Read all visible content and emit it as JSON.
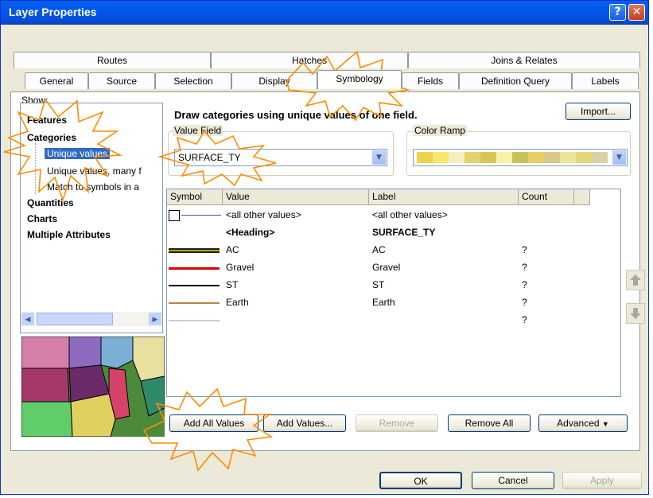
{
  "window": {
    "title": "Layer Properties",
    "help_label": "?",
    "close_label": "✕"
  },
  "tabs_row1": [
    "Routes",
    "Hatches",
    "Joins & Relates"
  ],
  "tabs_row2": [
    "General",
    "Source",
    "Selection",
    "Display",
    "Symbology",
    "Fields",
    "Definition Query",
    "Labels"
  ],
  "active_tab": "Symbology",
  "show": {
    "label": "Show:",
    "items": [
      "Features",
      "Categories",
      "Unique values",
      "Unique values, many f",
      "Match to symbols in a",
      "Quantities",
      "Charts",
      "Multiple Attributes"
    ],
    "selected": "Unique values"
  },
  "description": "Draw categories using unique values of one field.",
  "import_label": "Import...",
  "value_field": {
    "label": "Value Field",
    "value": "SURFACE_TY"
  },
  "color_ramp": {
    "label": "Color Ramp",
    "colors": [
      "#f0d34a",
      "#f7e86a",
      "#f3f0bd",
      "#e2d36b",
      "#d9c552",
      "#f7f3a8",
      "#c7c25a",
      "#e8cf66",
      "#d9c88a",
      "#ebe49a",
      "#e6d77a",
      "#d8d0a6"
    ]
  },
  "table": {
    "headers": [
      "Symbol",
      "Value",
      "Label",
      "Count"
    ],
    "rows": [
      {
        "value": "<all other values>",
        "label": "<all other values>",
        "count": "",
        "bold": false,
        "symbol": "box-line",
        "color": "#6a3fbf"
      },
      {
        "value": "<Heading>",
        "label": "SURFACE_TY",
        "count": "",
        "bold": true,
        "symbol": "none",
        "color": ""
      },
      {
        "value": "AC",
        "label": "AC",
        "count": "?",
        "bold": false,
        "symbol": "double-line",
        "color": "#b8a000"
      },
      {
        "value": "Gravel",
        "label": "Gravel",
        "count": "?",
        "bold": false,
        "symbol": "line",
        "color": "#e00000"
      },
      {
        "value": "ST",
        "label": "ST",
        "count": "?",
        "bold": false,
        "symbol": "line",
        "color": "#000000"
      },
      {
        "value": "Earth",
        "label": "Earth",
        "count": "?",
        "bold": false,
        "symbol": "line",
        "color": "#b8864b"
      },
      {
        "value": "",
        "label": "",
        "count": "?",
        "bold": false,
        "symbol": "line",
        "color": "#c8c8d8"
      }
    ]
  },
  "buttons": {
    "add_all": "Add All Values",
    "add": "Add Values...",
    "remove": "Remove",
    "remove_all": "Remove All",
    "advanced": "Advanced",
    "ok": "OK",
    "cancel": "Cancel",
    "apply": "Apply"
  },
  "icons": {
    "up": "arrow-up-icon",
    "down": "arrow-down-icon",
    "scroll_left": "scroll-left-icon",
    "scroll_right": "scroll-right-icon"
  }
}
